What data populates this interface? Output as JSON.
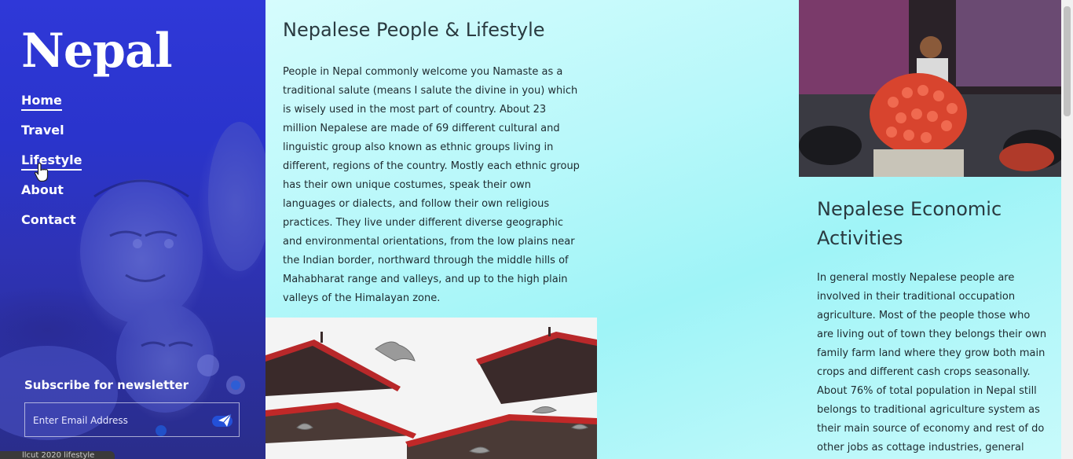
{
  "sidebar": {
    "brand": "Nepal",
    "nav": [
      {
        "label": "Home"
      },
      {
        "label": "Travel"
      },
      {
        "label": "Lifestyle"
      },
      {
        "label": "About"
      },
      {
        "label": "Contact"
      }
    ],
    "newsletter": {
      "title": "Subscribe for newsletter",
      "placeholder": "Enter Email Address",
      "send_icon": "paper-plane-icon"
    },
    "copyright": "llcut 2020 lifestyle"
  },
  "main": {
    "people": {
      "title": "Nepalese People & Lifestyle",
      "body": "People in Nepal commonly welcome you Namaste as a traditional salute (means I salute the divine in you) which is wisely used in the most part of country. About 23 million Nepalese are made of 69 different cultural and linguistic group also known as ethnic groups living in different, regions of the country. Mostly each ethnic group has their own unique costumes, speak their own languages or dialects, and follow their own religious practices. They live under different diverse geographic and environmental orientations, from the low plains near the Indian border, northward through the middle hills of Mahabharat range and valleys, and up to the high plain valleys of the Himalayan zone."
    },
    "economy": {
      "title": "Nepalese Economic Activities",
      "body": "In general mostly Nepalese people are involved in their traditional occupation agriculture. Most of the people those who are living out of town they belongs their own family farm land where they grow both main crops and different cash crops seasonally. About 76% of total population in Nepal still belongs to traditional agriculture system as their main source of economy and rest of do other jobs as cottage industries, general manufactures, goods trading,"
    }
  },
  "colors": {
    "sidebar": "#2f38d8",
    "content_bg": "#b8f8fa",
    "text": "#1e2a2f"
  }
}
